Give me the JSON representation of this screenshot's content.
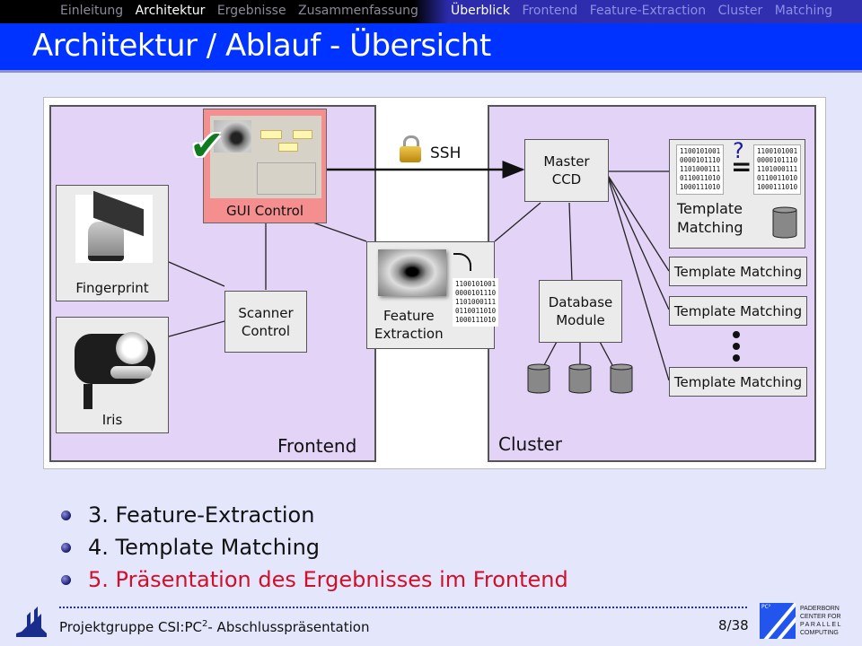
{
  "navigation": {
    "sections": [
      {
        "label": "Einleitung",
        "active": false
      },
      {
        "label": "Architektur",
        "active": true
      },
      {
        "label": "Ergebnisse",
        "active": false
      },
      {
        "label": "Zusammenfassung",
        "active": false
      }
    ],
    "subsections": [
      {
        "label": "Überblick",
        "active": true
      },
      {
        "label": "Frontend",
        "active": false
      },
      {
        "label": "Feature-Extraction",
        "active": false
      },
      {
        "label": "Cluster",
        "active": false
      },
      {
        "label": "Matching",
        "active": false
      }
    ]
  },
  "slide": {
    "title": "Architektur / Ablauf - Übersicht"
  },
  "diagram": {
    "frontend_label": "Frontend",
    "cluster_label": "Cluster",
    "gui_control": "GUI Control",
    "fingerprint": "Fingerprint",
    "iris": "Iris",
    "scanner_control": [
      "Scanner",
      "Control"
    ],
    "ssh": "SSH",
    "feature_extraction": [
      "Feature",
      "Extraction"
    ],
    "master_ccd": [
      "Master",
      "CCD"
    ],
    "database_module": [
      "Database",
      "Module"
    ],
    "template_matching_main": [
      "Template",
      "Matching"
    ],
    "template_matching_nodes": [
      "Template Matching",
      "Template Matching",
      "Template Matching"
    ],
    "binary_code": "1100101001\n0000101110\n1101000111\n0110011010\n1000111010",
    "compare_symbol": "?",
    "equals_symbol": "="
  },
  "bullets": [
    {
      "text": "3. Feature-Extraction",
      "highlight": false
    },
    {
      "text": "4. Template Matching",
      "highlight": false
    },
    {
      "text": "5. Präsentation des Ergebnisses im Frontend",
      "highlight": true
    }
  ],
  "footer": {
    "title_prefix": "Projektgruppe CSI:PC",
    "title_sup": "2",
    "title_suffix": "- Abschlusspräsentation",
    "page": "8/38",
    "logo_small": "PC²",
    "logo_lines": [
      "PADERBORN",
      "CENTER FOR",
      "PARALLEL",
      "COMPUTING"
    ]
  },
  "colors": {
    "title_bar": "#0033ff",
    "panel": "#e3d4f7",
    "gui_box": "#f58e8e",
    "highlight": "#d0102a"
  }
}
